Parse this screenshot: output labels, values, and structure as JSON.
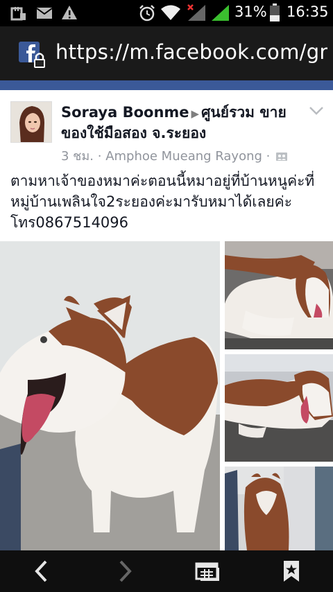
{
  "status_bar": {
    "battery": "31%",
    "time": "16:35",
    "icons": [
      "usb-debug-icon",
      "mail-icon",
      "warning-icon",
      "alarm-icon",
      "wifi-icon",
      "signal-icon",
      "signal-icon",
      "battery-icon"
    ]
  },
  "browser": {
    "url": "https://m.facebook.com/grc",
    "favicon": "facebook-lock-icon"
  },
  "post": {
    "author": "Soraya Boonme",
    "group": "ศูนย์รวม ขายของใช้มือสอง จ.ระยอง",
    "time": "3 ชม.",
    "separator": "·",
    "location": "Amphoe Mueang Rayong",
    "audience_icon": "group-audience-icon",
    "text": "ตามหาเจ้าของหมาค่ะตอนนี้หมาอยู่ที่บ้านหนูค่ะที่หมู่บ้านเพลินใจ2ระยองค่ะมารับหมาได้เลยค่ะโทร0867514096"
  },
  "photos": [
    {
      "name": "husky-standing-photo"
    },
    {
      "name": "husky-lying-photo-1"
    },
    {
      "name": "husky-lying-photo-2"
    },
    {
      "name": "husky-back-photo"
    }
  ],
  "nav": {
    "icons": [
      "back-icon",
      "forward-icon",
      "tabs-icon",
      "bookmark-icon"
    ]
  },
  "colors": {
    "facebook_blue": "#3b5998",
    "meta_gray": "#90949c"
  }
}
